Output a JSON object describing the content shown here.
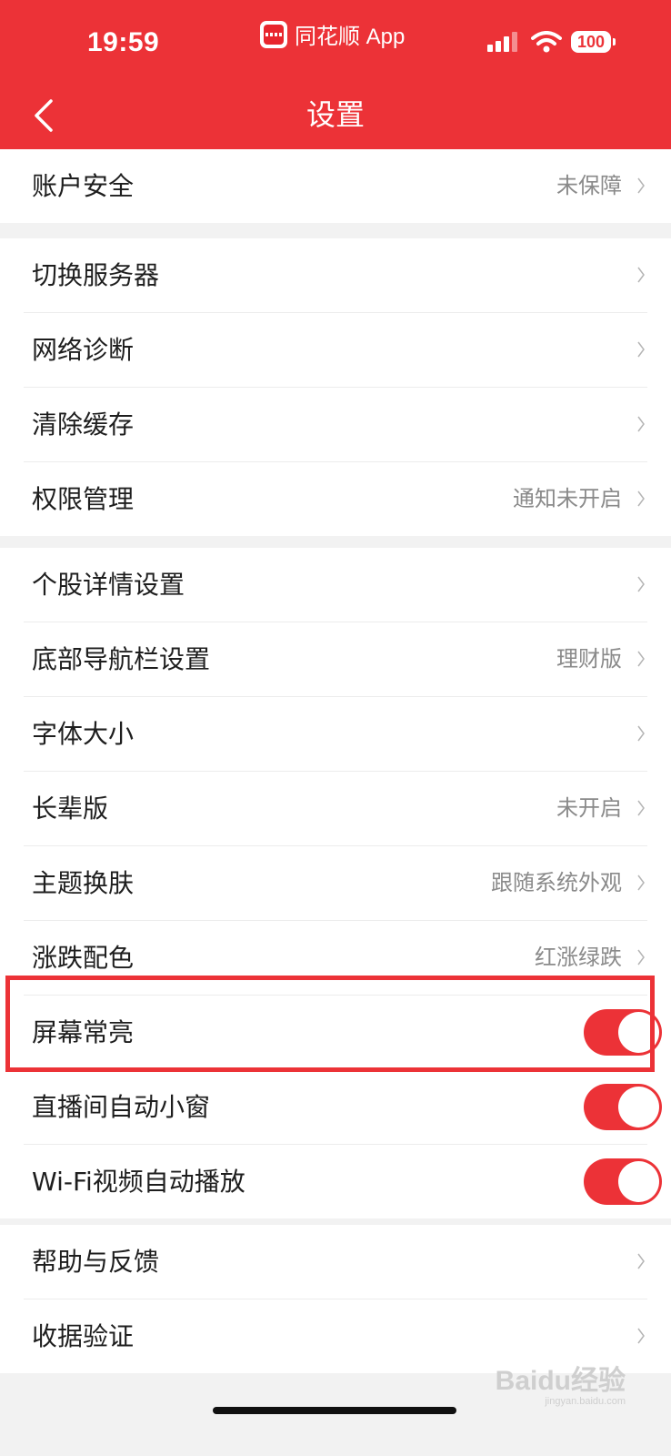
{
  "status_bar": {
    "time": "19:59",
    "app_name": "同花顺 App",
    "battery": "100"
  },
  "header": {
    "title": "设置"
  },
  "groups": [
    {
      "items": [
        {
          "label": "账户安全",
          "value": "未保障"
        }
      ]
    },
    {
      "items": [
        {
          "label": "切换服务器",
          "value": ""
        },
        {
          "label": "网络诊断",
          "value": ""
        },
        {
          "label": "清除缓存",
          "value": ""
        },
        {
          "label": "权限管理",
          "value": "通知未开启"
        }
      ]
    },
    {
      "items": [
        {
          "label": "个股详情设置",
          "value": ""
        },
        {
          "label": "底部导航栏设置",
          "value": "理财版"
        },
        {
          "label": "字体大小",
          "value": ""
        },
        {
          "label": "长辈版",
          "value": "未开启"
        },
        {
          "label": "主题换肤",
          "value": "跟随系统外观"
        },
        {
          "label": "涨跌配色",
          "value": "红涨绿跌"
        },
        {
          "label": "屏幕常亮",
          "toggle": true
        },
        {
          "label": "直播间自动小窗",
          "toggle": true
        },
        {
          "label": "Wi-Fi视频自动播放",
          "toggle": true
        }
      ]
    },
    {
      "items": [
        {
          "label": "帮助与反馈",
          "value": ""
        },
        {
          "label": "收据验证",
          "value": ""
        }
      ]
    }
  ],
  "watermark": {
    "text": "Baidu经验",
    "sub": "jingyan.baidu.com"
  },
  "colors": {
    "accent": "#ec3237",
    "background": "#f2f2f2"
  },
  "icons": {
    "back": "chevron-left-icon",
    "row": "chevron-right-icon"
  }
}
